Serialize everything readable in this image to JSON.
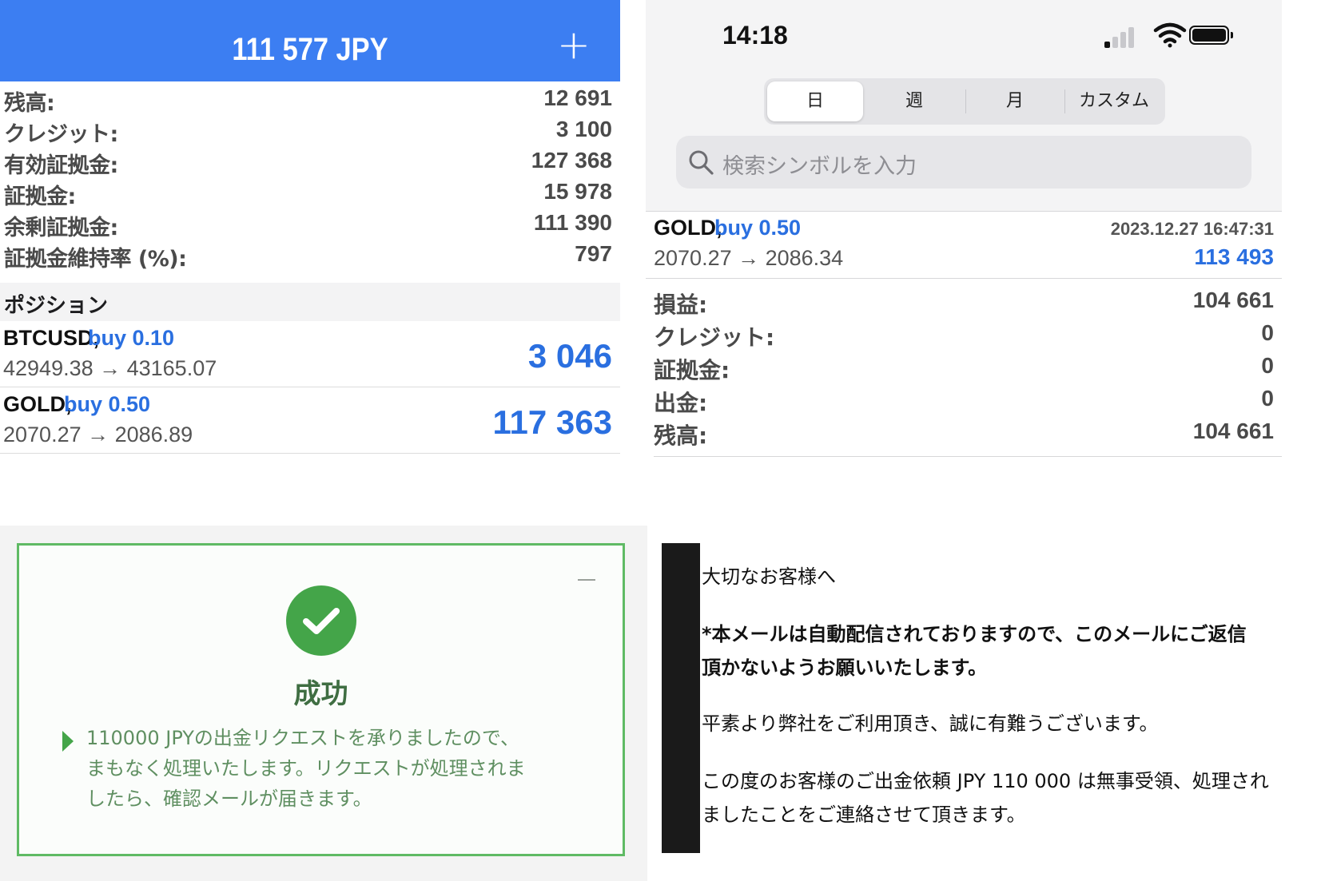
{
  "account_panel": {
    "equity_header": "111 577 JPY",
    "add_symbol": "+",
    "rows": [
      {
        "label": "残高:",
        "value": "12 691"
      },
      {
        "label": "クレジット:",
        "value": "3 100"
      },
      {
        "label": "有効証拠金:",
        "value": "127 368"
      },
      {
        "label": "証拠金:",
        "value": "15 978"
      },
      {
        "label": "余剰証拠金:",
        "value": "111 390"
      },
      {
        "label": "証拠金維持率 (%):",
        "value": "797"
      }
    ],
    "positions_title": "ポジション",
    "positions": [
      {
        "symbol": "BTCUSD,",
        "side": "buy 0.10",
        "prices": "42949.38 → 43165.07",
        "profit": "3 046"
      },
      {
        "symbol": "GOLD,",
        "side": "buy 0.50",
        "prices": "2070.27 → 2086.89",
        "profit": "117 363"
      }
    ]
  },
  "history_panel": {
    "status_time": "14:18",
    "period_tabs": [
      "日",
      "週",
      "月",
      "カスタム"
    ],
    "active_tab": "日",
    "search_placeholder": "検索シンボルを入力",
    "deal": {
      "symbol": "GOLD,",
      "side": "buy 0.50",
      "time": "2023.12.27 16:47:31",
      "prices": "2070.27 → 2086.34",
      "profit": "113 493"
    },
    "summary": [
      {
        "label": "損益:",
        "value": "104 661"
      },
      {
        "label": "クレジット:",
        "value": "0"
      },
      {
        "label": "証拠金:",
        "value": "0"
      },
      {
        "label": "出金:",
        "value": "0"
      },
      {
        "label": "残高:",
        "value": "104 661"
      }
    ]
  },
  "success_card": {
    "title": "成功",
    "message_lines": [
      "110000 JPYの出金リクエストを承りましたので、",
      "まもなく処理いたします。リクエストが処理されま",
      "したら、確認メールが届きます。"
    ]
  },
  "email": {
    "greeting": "大切なお客様へ",
    "notice_lines": [
      "*本メールは自動配信されておりますので、このメールにご返信",
      "頂かないようお願いいたします。"
    ],
    "thanks": "平素より弊社をご利用頂き、誠に有難うございます。",
    "body_lines": [
      "この度のお客様のご出金依頼 JPY 110 000 は無事受領、処理され",
      "ましたことをご連絡させて頂きます。"
    ]
  },
  "colors": {
    "header_blue": "#3c7ef2",
    "profit_blue": "#2a6fe0",
    "success_green": "#44a549",
    "card_border": "#5fba64"
  },
  "icons": {
    "plus": "plus-icon",
    "search": "search-icon",
    "signal": "cellular-signal-icon",
    "wifi": "wifi-icon",
    "battery": "battery-icon",
    "check": "check-circle-icon",
    "arrow": "triangle-bullet-icon",
    "minimize": "minimize-icon"
  }
}
